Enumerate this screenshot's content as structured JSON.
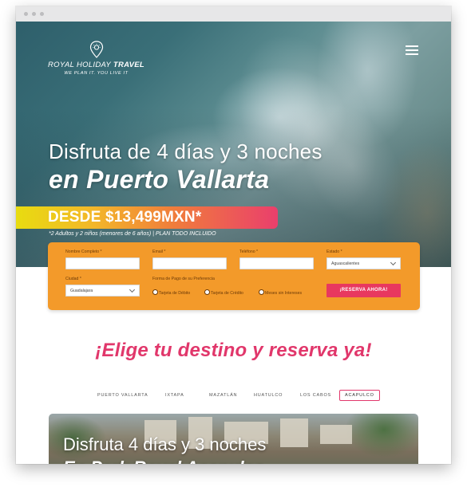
{
  "brand": {
    "name_light": "ROYAL HOLIDAY",
    "name_bold": "TRAVEL",
    "tagline": "WE PLAN IT. YOU LIVE IT"
  },
  "hero": {
    "title_line1": "Disfruta de 4 días y 3 noches",
    "title_line2": "en Puerto Vallarta",
    "price": "DESDE $13,499MXN*",
    "price_note": "*2 Adultos y 2 niños (menores de 6 años) | PLAN TODO INCLUIDO"
  },
  "form": {
    "name_label": "Nombre Completo *",
    "email_label": "Email *",
    "phone_label": "Teléfono *",
    "state_label": "Estado *",
    "state_value": "Aguascalientes",
    "city_label": "Ciudad *",
    "city_value": "Guadalajara",
    "payment_label": "Forma de Pago de su Preferencia",
    "payment_options": [
      "Tarjeta de Débito",
      "Tarjeta de Crédito",
      "Meses sin Intereses"
    ],
    "submit_label": "¡RESERVA AHORA!"
  },
  "section": {
    "heading": "¡Elige tu destino y reserva ya!"
  },
  "tabs": [
    "PUERTO VALLARTA",
    "IXTAPA",
    "MAZATLÁN",
    "HUATULCO",
    "LOS CABOS",
    "ACAPULCO"
  ],
  "active_tab": "ACAPULCO",
  "resort": {
    "title_line1": "Disfruta 4 días y 3 noches",
    "title_line2": "En Park Royal Acapulco"
  },
  "colors": {
    "accent_pink": "#e1376b",
    "form_orange": "#f39a2a",
    "button_pink": "#e8385f"
  }
}
